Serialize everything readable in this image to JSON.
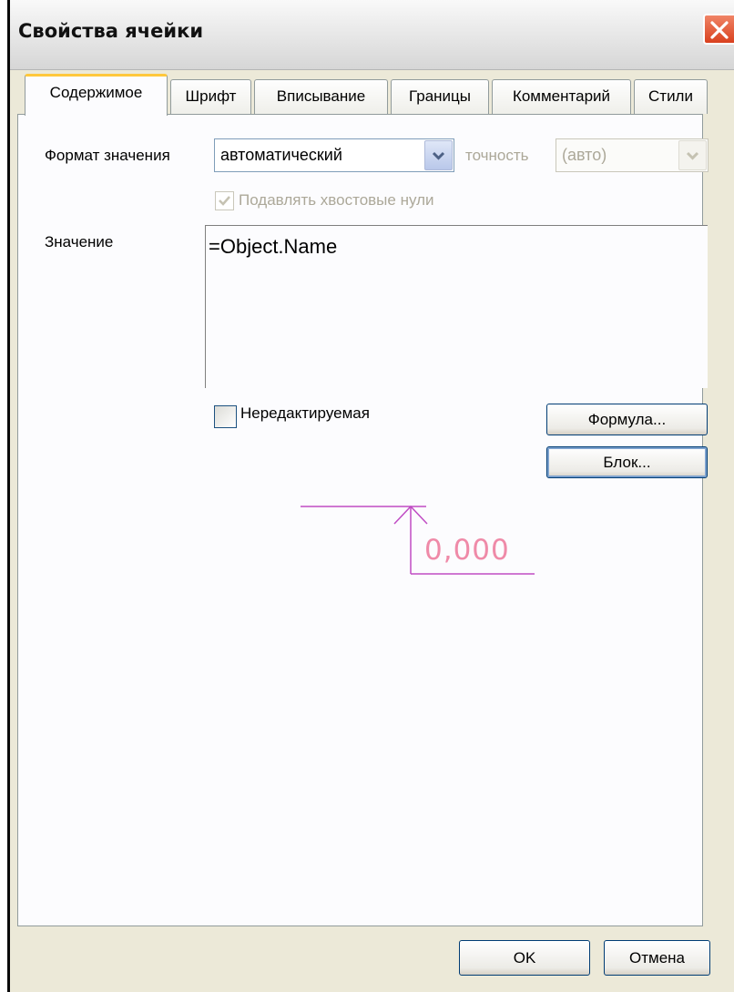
{
  "window": {
    "title": "Свойства ячейки"
  },
  "tabs": [
    {
      "label": "Содержимое",
      "active": true
    },
    {
      "label": "Шрифт",
      "active": false
    },
    {
      "label": "Вписывание",
      "active": false
    },
    {
      "label": "Границы",
      "active": false
    },
    {
      "label": "Комментарий",
      "active": false
    },
    {
      "label": "Стили",
      "active": false
    }
  ],
  "content": {
    "format_label": "Формат значения",
    "format_value": "автоматический",
    "precision_label": "точность",
    "precision_value": "(авто)",
    "suppress_zeros_label": "Подавлять хвостовые нули",
    "suppress_zeros_checked": true,
    "value_label": "Значение",
    "value_text": "=Object.Name",
    "readonly_label": "Нередактируемая",
    "readonly_checked": false,
    "formula_button": "Формула...",
    "block_button": "Блок...",
    "preview_value": "0,000"
  },
  "footer": {
    "ok_button": "OK",
    "cancel_button": "Отмена"
  },
  "colors": {
    "preview": "#ef8aa8",
    "dimension_line": "#c04cc4"
  }
}
